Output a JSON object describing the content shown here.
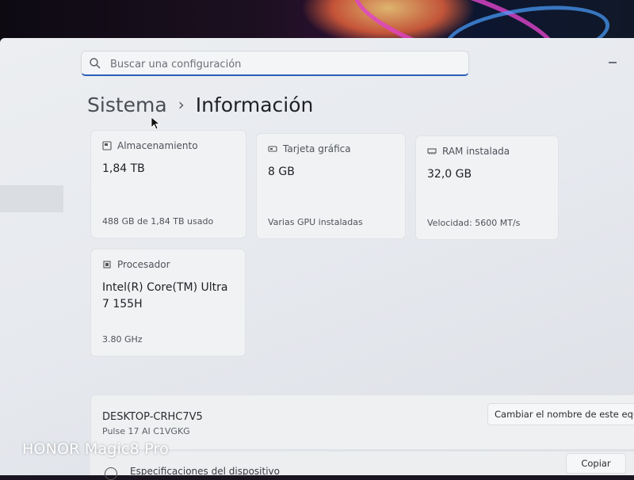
{
  "search": {
    "placeholder": "Buscar una configuración",
    "icon": "search-icon"
  },
  "breadcrumb": {
    "parent": "Sistema",
    "separator": "›",
    "current": "Información"
  },
  "cards": {
    "storage": {
      "title": "Almacenamiento",
      "value": "1,84 TB",
      "detail": "488 GB de 1,84 TB usado",
      "icon": "storage-icon"
    },
    "gpu": {
      "title": "Tarjeta gráfica",
      "value": "8 GB",
      "detail": "Varias GPU instaladas",
      "icon": "gpu-icon"
    },
    "ram": {
      "title": "RAM instalada",
      "value": "32,0 GB",
      "detail": "Velocidad: 5600 MT/s",
      "icon": "ram-icon"
    },
    "cpu": {
      "title": "Procesador",
      "value": "Intel(R) Core(TM) Ultra 7 155H",
      "detail": "3.80 GHz",
      "icon": "cpu-icon"
    }
  },
  "device": {
    "name": "DESKTOP-CRHC7V5",
    "model": "Pulse 17 AI C1VGKG",
    "rename_label": "Cambiar el nombre de este equipo"
  },
  "specs": {
    "copy_label": "Copiar",
    "section_label": "Especificaciones del dispositivo"
  },
  "watermark": "HONOR Magic8 Pro"
}
